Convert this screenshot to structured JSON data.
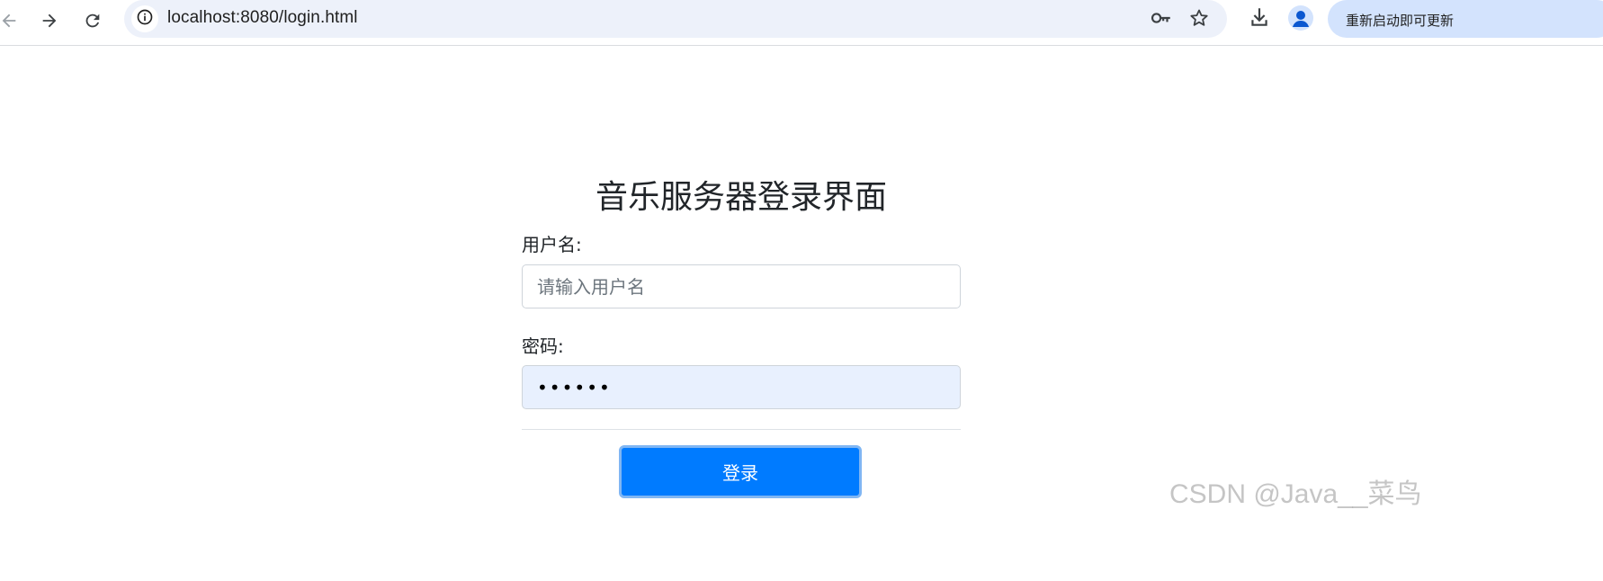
{
  "browser": {
    "url": "localhost:8080/login.html",
    "restart_label": "重新启动即可更新",
    "icons": {
      "back": "arrow-left-icon",
      "forward": "arrow-right-icon",
      "reload": "reload-icon",
      "site_info": "info-icon",
      "passwords": "key-icon",
      "bookmark": "star-icon",
      "download": "download-icon",
      "profile": "person-icon"
    }
  },
  "login": {
    "title": "音乐服务器登录界面",
    "username_label": "用户名:",
    "username_placeholder": "请输入用户名",
    "password_label": "密码:",
    "password_value": "••••••",
    "submit_label": "登录"
  },
  "watermark": "CSDN @Java__菜鸟",
  "colors": {
    "primary": "#007bff",
    "omnibox_bg": "#edf1fa",
    "autofill_bg": "#e8f0fe"
  }
}
